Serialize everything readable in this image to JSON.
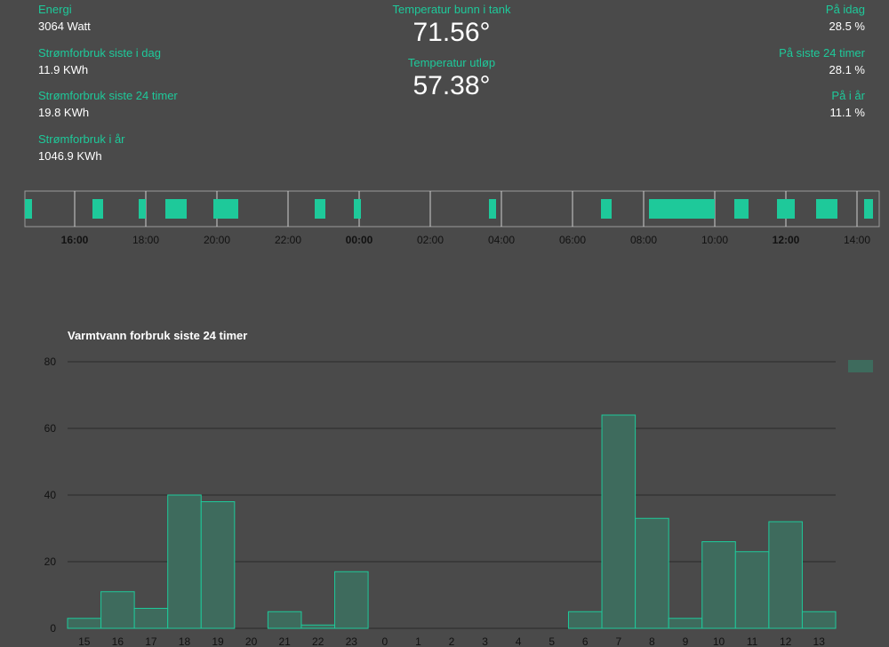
{
  "stats_left": [
    {
      "label": "Energi",
      "value": "3064 Watt"
    },
    {
      "label": "Strømforbruk siste i dag",
      "value": "11.9 KWh"
    },
    {
      "label": "Strømforbruk siste 24 timer",
      "value": "19.8 KWh"
    },
    {
      "label": "Strømforbruk i år",
      "value": "1046.9 KWh"
    }
  ],
  "stats_center": [
    {
      "label": "Temperatur bunn i tank",
      "value": "71.56°"
    },
    {
      "label": "Temperatur utløp",
      "value": "57.38°"
    }
  ],
  "stats_right": [
    {
      "label": "På idag",
      "value": "28.5 %"
    },
    {
      "label": "På siste 24 timer",
      "value": "28.1 %"
    },
    {
      "label": "På i år",
      "value": "11.1 %"
    }
  ],
  "timeline": {
    "ticks": [
      {
        "time": "16:00",
        "bold": true
      },
      {
        "time": "18:00",
        "bold": false
      },
      {
        "time": "20:00",
        "bold": false
      },
      {
        "time": "22:00",
        "bold": false
      },
      {
        "time": "00:00",
        "bold": true
      },
      {
        "time": "02:00",
        "bold": false
      },
      {
        "time": "04:00",
        "bold": false
      },
      {
        "time": "06:00",
        "bold": false
      },
      {
        "time": "08:00",
        "bold": false
      },
      {
        "time": "10:00",
        "bold": false
      },
      {
        "time": "12:00",
        "bold": true
      },
      {
        "time": "14:00",
        "bold": false
      }
    ],
    "on_periods_hours_after_1600": [
      [
        -1.4,
        -1.2
      ],
      [
        0.5,
        0.8
      ],
      [
        1.8,
        2.0
      ],
      [
        2.55,
        3.15
      ],
      [
        3.9,
        4.6
      ],
      [
        6.75,
        7.05
      ],
      [
        7.85,
        8.05
      ],
      [
        11.65,
        11.85
      ],
      [
        14.8,
        15.1
      ],
      [
        16.15,
        17.1
      ],
      [
        17.1,
        18.0
      ],
      [
        18.55,
        18.95
      ],
      [
        19.75,
        20.25
      ],
      [
        20.85,
        21.45
      ],
      [
        22.2,
        22.45
      ]
    ],
    "bar_color": "#1ec99a"
  },
  "chart_data": {
    "type": "bar",
    "title": "Varmtvann forbruk siste 24 timer",
    "categories": [
      "15",
      "16",
      "17",
      "18",
      "19",
      "20",
      "21",
      "22",
      "23",
      "0",
      "1",
      "2",
      "3",
      "4",
      "5",
      "6",
      "7",
      "8",
      "9",
      "10",
      "11",
      "12",
      "13"
    ],
    "series": [
      {
        "values": [
          3,
          11,
          6,
          40,
          38,
          0,
          5,
          1,
          17,
          0,
          0,
          0,
          0,
          0,
          0,
          5,
          64,
          33,
          3,
          26,
          23,
          32,
          5
        ]
      }
    ],
    "ylim": [
      0,
      80
    ],
    "yticks": [
      0,
      20,
      40,
      60,
      80
    ],
    "grid": true,
    "legend": "top-right",
    "bar_fill": "#3e6b5d",
    "bar_stroke": "#1ec99a"
  }
}
